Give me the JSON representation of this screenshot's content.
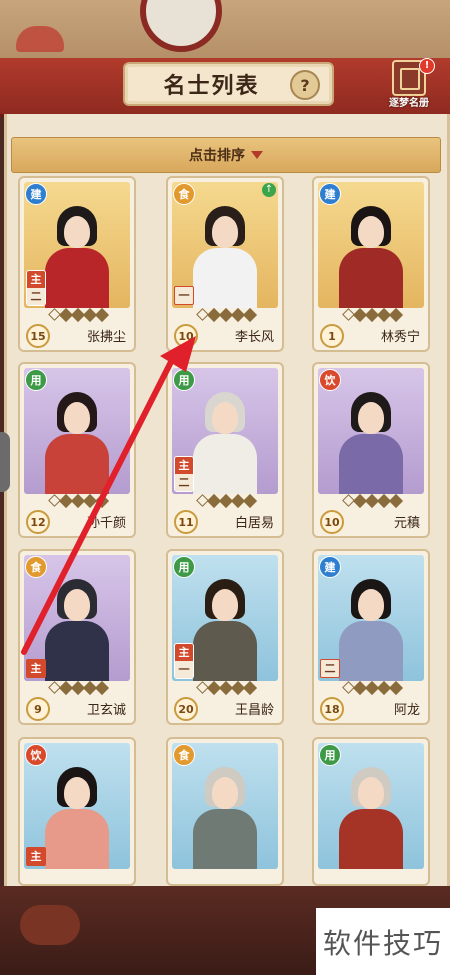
{
  "header": {
    "title": "名士列表",
    "help_label": "?",
    "book_label": "逐梦名册",
    "book_alert": "!"
  },
  "sort": {
    "label": "点击排序"
  },
  "cards": [
    {
      "name": "张拂尘",
      "level": "15",
      "category": "建",
      "bg": "gold",
      "role_top": "主",
      "role_bottom": "二",
      "stars": [
        1,
        0,
        0,
        0,
        0
      ]
    },
    {
      "name": "李长风",
      "level": "10",
      "category": "食",
      "bg": "gold",
      "role_bottom": "一",
      "up": "↑",
      "stars": [
        1,
        0,
        0,
        0,
        0
      ]
    },
    {
      "name": "林秀宁",
      "level": "1",
      "category": "建",
      "bg": "gold",
      "stars": [
        1,
        0,
        0,
        0,
        0
      ]
    },
    {
      "name": "孙千颜",
      "level": "12",
      "category": "用",
      "bg": "purple",
      "stars": [
        1,
        0,
        0,
        0,
        0
      ]
    },
    {
      "name": "白居易",
      "level": "11",
      "category": "用",
      "bg": "purple",
      "role_top": "主",
      "role_bottom": "二",
      "stars": [
        1,
        0,
        0,
        0,
        0
      ]
    },
    {
      "name": "元稹",
      "level": "10",
      "category": "饮",
      "bg": "purple",
      "stars": [
        1,
        0,
        0,
        0,
        0
      ]
    },
    {
      "name": "卫玄诚",
      "level": "9",
      "category": "食",
      "bg": "purple",
      "role_single": "主",
      "stars": [
        1,
        0,
        0,
        0,
        0
      ]
    },
    {
      "name": "王昌龄",
      "level": "20",
      "category": "用",
      "bg": "blue",
      "role_top": "主",
      "role_bottom": "一",
      "stars": [
        1,
        0,
        0,
        0,
        0
      ]
    },
    {
      "name": "阿龙",
      "level": "18",
      "category": "建",
      "bg": "blue",
      "role_bottom": "二",
      "stars": [
        1,
        0,
        0,
        0,
        0
      ]
    },
    {
      "name": "",
      "level": "",
      "category": "饮",
      "bg": "blue",
      "role_single": "主",
      "stars": []
    },
    {
      "name": "",
      "level": "",
      "category": "食",
      "bg": "blue",
      "stars": []
    },
    {
      "name": "",
      "level": "",
      "category": "用",
      "bg": "blue",
      "stars": []
    }
  ],
  "watermark": "软件技巧",
  "colors": {
    "header_red": "#a8352a",
    "panel": "#efe4cf",
    "arrow": "#e0202a"
  }
}
